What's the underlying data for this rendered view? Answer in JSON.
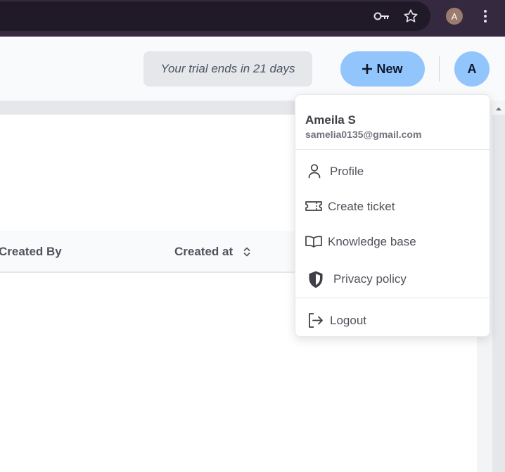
{
  "browser": {
    "profile_initial": "A",
    "icons": [
      "key-icon",
      "star-icon",
      "kebab-menu-icon"
    ]
  },
  "header": {
    "trial_text": "Your trial ends in 21 days",
    "new_button": {
      "icon": "plus-icon",
      "label": "New"
    },
    "avatar_initial": "A"
  },
  "table": {
    "columns": [
      "Created By",
      "Created at"
    ],
    "sort_icon": "sort-icon"
  },
  "user_menu": {
    "name": "Ameila S",
    "email": "samelia0135@gmail.com",
    "items": [
      {
        "label": "Profile",
        "icon": "user-icon"
      },
      {
        "label": "Create ticket",
        "icon": "ticket-icon"
      },
      {
        "label": "Knowledge base",
        "icon": "book-icon"
      },
      {
        "label": "Privacy policy",
        "icon": "shield-icon"
      },
      {
        "label": "Logout",
        "icon": "logout-icon"
      }
    ]
  },
  "colors": {
    "chrome_bg": "#35293f",
    "omnibox_bg": "#201a28",
    "accent": "#93c5fd",
    "trial_bg": "#e5e7eb"
  }
}
